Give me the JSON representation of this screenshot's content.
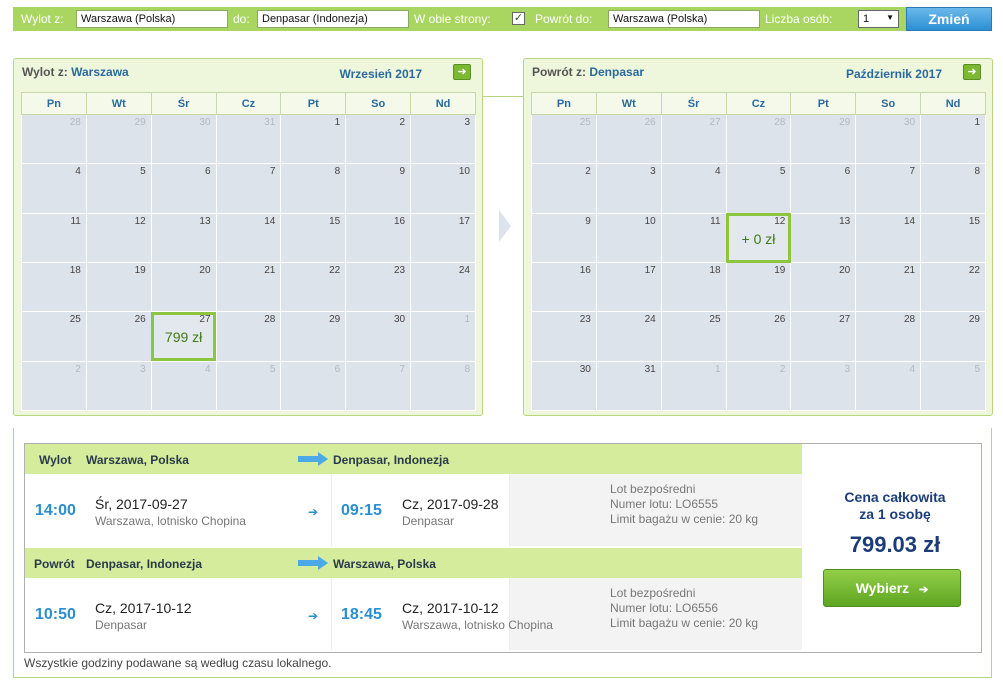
{
  "search": {
    "from_label": "Wylot z:",
    "from_value": "Warszawa (Polska)",
    "to_label": "do:",
    "to_value": "Denpasar (Indonezja)",
    "roundtrip_label": "W obie strony:",
    "roundtrip_checked": "✓",
    "return_label": "Powrót do:",
    "return_value": "Warszawa (Polska)",
    "people_label": "Liczba osób:",
    "people_value": "1",
    "submit_label": "Zmień"
  },
  "weekdays": [
    "Pn",
    "Wt",
    "Śr",
    "Cz",
    "Pt",
    "So",
    "Nd"
  ],
  "outbound_calendar": {
    "title_prefix": "Wylot z:",
    "title_city": "Warszawa",
    "month": "Wrzesień 2017",
    "weeks": [
      [
        {
          "d": "28",
          "dim": true
        },
        {
          "d": "29",
          "dim": true
        },
        {
          "d": "30",
          "dim": true
        },
        {
          "d": "31",
          "dim": true
        },
        {
          "d": "1"
        },
        {
          "d": "2"
        },
        {
          "d": "3"
        }
      ],
      [
        {
          "d": "4"
        },
        {
          "d": "5"
        },
        {
          "d": "6"
        },
        {
          "d": "7"
        },
        {
          "d": "8"
        },
        {
          "d": "9"
        },
        {
          "d": "10"
        }
      ],
      [
        {
          "d": "11"
        },
        {
          "d": "12"
        },
        {
          "d": "13"
        },
        {
          "d": "14"
        },
        {
          "d": "15"
        },
        {
          "d": "16"
        },
        {
          "d": "17"
        }
      ],
      [
        {
          "d": "18"
        },
        {
          "d": "19"
        },
        {
          "d": "20"
        },
        {
          "d": "21"
        },
        {
          "d": "22"
        },
        {
          "d": "23"
        },
        {
          "d": "24"
        }
      ],
      [
        {
          "d": "25"
        },
        {
          "d": "26"
        },
        {
          "d": "27",
          "selected": true,
          "price": "799 zł"
        },
        {
          "d": "28"
        },
        {
          "d": "29"
        },
        {
          "d": "30"
        },
        {
          "d": "1",
          "dim": true
        }
      ],
      [
        {
          "d": "2",
          "dim": true
        },
        {
          "d": "3",
          "dim": true
        },
        {
          "d": "4",
          "dim": true
        },
        {
          "d": "5",
          "dim": true
        },
        {
          "d": "6",
          "dim": true
        },
        {
          "d": "7",
          "dim": true
        },
        {
          "d": "8",
          "dim": true
        }
      ]
    ]
  },
  "return_calendar": {
    "title_prefix": "Powrót z:",
    "title_city": "Denpasar",
    "month": "Październik 2017",
    "weeks": [
      [
        {
          "d": "25",
          "dim": true
        },
        {
          "d": "26",
          "dim": true
        },
        {
          "d": "27",
          "dim": true
        },
        {
          "d": "28",
          "dim": true
        },
        {
          "d": "29",
          "dim": true
        },
        {
          "d": "30",
          "dim": true
        },
        {
          "d": "1"
        }
      ],
      [
        {
          "d": "2"
        },
        {
          "d": "3"
        },
        {
          "d": "4"
        },
        {
          "d": "5"
        },
        {
          "d": "6"
        },
        {
          "d": "7"
        },
        {
          "d": "8"
        }
      ],
      [
        {
          "d": "9"
        },
        {
          "d": "10"
        },
        {
          "d": "11"
        },
        {
          "d": "12",
          "selected": true,
          "price": "+ 0 zł"
        },
        {
          "d": "13"
        },
        {
          "d": "14"
        },
        {
          "d": "15"
        }
      ],
      [
        {
          "d": "16"
        },
        {
          "d": "17"
        },
        {
          "d": "18"
        },
        {
          "d": "19"
        },
        {
          "d": "20"
        },
        {
          "d": "21"
        },
        {
          "d": "22"
        }
      ],
      [
        {
          "d": "23"
        },
        {
          "d": "24"
        },
        {
          "d": "25"
        },
        {
          "d": "26"
        },
        {
          "d": "27"
        },
        {
          "d": "28"
        },
        {
          "d": "29"
        }
      ],
      [
        {
          "d": "30"
        },
        {
          "d": "31"
        },
        {
          "d": "1",
          "dim": true
        },
        {
          "d": "2",
          "dim": true
        },
        {
          "d": "3",
          "dim": true
        },
        {
          "d": "4",
          "dim": true
        },
        {
          "d": "5",
          "dim": true
        }
      ]
    ]
  },
  "outbound": {
    "label": "Wylot",
    "from": "Warszawa, Polska",
    "to": "Denpasar, Indonezja",
    "dep_time": "14:00",
    "dep_date": "Śr, 2017-09-27",
    "dep_place": "Warszawa, lotnisko Chopina",
    "arr_time": "09:15",
    "arr_date": "Cz, 2017-09-28",
    "arr_place": "Denpasar",
    "info1": "Lot bezpośredni",
    "info2": "Numer lotu: LO6555",
    "info3": "Limit bagażu w cenie: 20 kg"
  },
  "return": {
    "label": "Powrót",
    "from": "Denpasar, Indonezja",
    "to": "Warszawa, Polska",
    "dep_time": "10:50",
    "dep_date": "Cz, 2017-10-12",
    "dep_place": "Denpasar",
    "arr_time": "18:45",
    "arr_date": "Cz, 2017-10-12",
    "arr_place": "Warszawa, lotnisko Chopina",
    "info1": "Lot bezpośredni",
    "info2": "Numer lotu: LO6556",
    "info3": "Limit bagażu w cenie: 20 kg"
  },
  "price": {
    "title_line1": "Cena całkowita",
    "title_line2": "za 1 osobę",
    "total": "799.03 zł",
    "select_label": "Wybierz"
  },
  "footnote": "Wszystkie godziny podawane są według czasu lokalnego.",
  "colors": {
    "accent_green": "#a9d660",
    "selected_outline": "#8cc63e",
    "blue_text": "#2a8ed0",
    "price_navy": "#1d3d7a"
  }
}
